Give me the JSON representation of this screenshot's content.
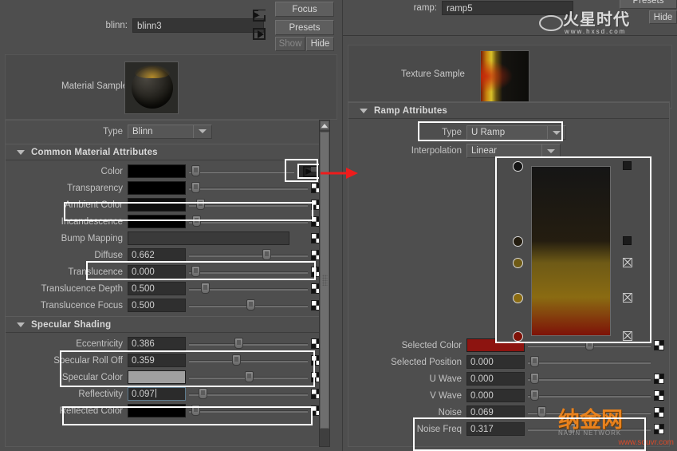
{
  "left_panel": {
    "node_label": "blinn:",
    "node_name": "blinn3",
    "buttons": {
      "focus": "Focus",
      "presets": "Presets",
      "show": "Show",
      "hide": "Hide"
    },
    "sample_label": "Material Sample",
    "type_label": "Type",
    "type_value": "Blinn",
    "sections": [
      {
        "title": "Common Material Attributes"
      },
      {
        "title": "Specular Shading"
      }
    ],
    "common_rows": [
      {
        "label": "Color",
        "kind": "color",
        "color": "#000000",
        "slider": 0.02,
        "map": "arrow",
        "highlight": false
      },
      {
        "label": "Transparency",
        "kind": "color",
        "color": "#000000",
        "slider": 0.02,
        "map": "checker",
        "highlight": false
      },
      {
        "label": "Ambient Color",
        "kind": "color",
        "color": "#0e0e0e",
        "slider": 0.06,
        "map": "checker",
        "highlight": true
      },
      {
        "label": "Incandescence",
        "kind": "color",
        "color": "#000000",
        "slider": 0.03,
        "map": "checker",
        "highlight": false
      },
      {
        "label": "Bump Mapping",
        "kind": "bump",
        "color": "#3a3a3a",
        "slider": null,
        "map": "checker",
        "highlight": false
      },
      {
        "label": "Diffuse",
        "kind": "value",
        "value": "0.662",
        "slider": 0.62,
        "map": "checker",
        "highlight": true
      },
      {
        "label": "Translucence",
        "kind": "value",
        "value": "0.000",
        "slider": 0.02,
        "map": "checker",
        "highlight": false
      },
      {
        "label": "Translucence Depth",
        "kind": "value",
        "value": "0.500",
        "slider": 0.1,
        "map": "checker",
        "highlight": false
      },
      {
        "label": "Translucence Focus",
        "kind": "value",
        "value": "0.500",
        "slider": 0.48,
        "map": "checker",
        "highlight": false
      }
    ],
    "specular_rows": [
      {
        "label": "Eccentricity",
        "kind": "value",
        "value": "0.386",
        "slider": 0.38,
        "map": "checker",
        "highlight": true
      },
      {
        "label": "Specular Roll Off",
        "kind": "value",
        "value": "0.359",
        "slider": 0.36,
        "map": "checker",
        "highlight": true
      },
      {
        "label": "Specular Color",
        "kind": "color",
        "color": "#a0a0a0",
        "slider": 0.47,
        "map": "checker",
        "highlight": false
      },
      {
        "label": "Reflectivity",
        "kind": "value",
        "value": "0.097",
        "slider": 0.08,
        "map": "checker",
        "highlight": true,
        "focused": true
      },
      {
        "label": "Reflected Color",
        "kind": "color",
        "color": "#000000",
        "slider": 0.02,
        "map": "checker",
        "highlight": false
      }
    ]
  },
  "right_panel": {
    "node_label": "ramp:",
    "node_name": "ramp5",
    "buttons": {
      "presets": "Presets",
      "hide": "Hide"
    },
    "sample_label": "Texture Sample",
    "section_title": "Ramp Attributes",
    "type_label": "Type",
    "type_value": "U Ramp",
    "interpolation_label": "Interpolation",
    "interpolation_value": "Linear",
    "ramp_stops": [
      {
        "position": 1.0,
        "color": "#151515"
      },
      {
        "position": 0.56,
        "color": "#241d10"
      },
      {
        "position": 0.43,
        "color": "#6e5a16"
      },
      {
        "position": 0.225,
        "color": "#8a6b12"
      },
      {
        "position": 0.0,
        "color": "#7e1208"
      }
    ],
    "rows": [
      {
        "label": "Selected Color",
        "kind": "color",
        "color": "#8d1410",
        "slider": 0.47,
        "map": "checker"
      },
      {
        "label": "Selected Position",
        "kind": "value",
        "value": "0.000",
        "slider": 0.02,
        "map": "none"
      },
      {
        "label": "U Wave",
        "kind": "value",
        "value": "0.000",
        "slider": 0.02,
        "map": "checker"
      },
      {
        "label": "V Wave",
        "kind": "value",
        "value": "0.000",
        "slider": 0.02,
        "map": "checker"
      },
      {
        "label": "Noise",
        "kind": "value",
        "value": "0.069",
        "slider": 0.08,
        "map": "checker",
        "highlight": true
      },
      {
        "label": "Noise Freq",
        "kind": "value",
        "value": "0.317",
        "slider": 0.32,
        "map": "checker",
        "highlight": true
      }
    ]
  },
  "watermarks": {
    "top_text": "火星时代",
    "top_url": "www.hxsd.com",
    "bottom_text": "纳金网",
    "bottom_sub": "NAJIN  NETWORK",
    "bottom_url": "www.souvr.com"
  },
  "annotations": {
    "arrow_color": "#ee1c1c",
    "highlight_color": "#ffffff"
  },
  "colors": {
    "panel_bg": "#4e4e4e",
    "field_bg": "#2f2f2f",
    "button_bg": "#5e5e5e",
    "text": "#c8c8c8"
  }
}
